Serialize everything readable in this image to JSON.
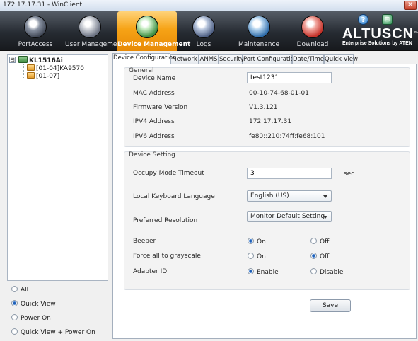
{
  "window": {
    "title": "172.17.17.31 - WinClient",
    "close_glyph": "✕"
  },
  "toolbar": {
    "items": [
      {
        "label": "PortAccess",
        "icon": "port-access-icon"
      },
      {
        "label": "User Management",
        "icon": "user-management-icon"
      },
      {
        "label": "Device Management",
        "icon": "device-management-icon",
        "active": true
      },
      {
        "label": "Logs",
        "icon": "logs-icon"
      },
      {
        "label": "Maintenance",
        "icon": "maintenance-icon"
      },
      {
        "label": "Download",
        "icon": "download-icon"
      }
    ],
    "help_glyph": "?",
    "config_glyph": "⊟",
    "brand": "ALTUSCN",
    "brand_tm": "™",
    "brand_sub": "Enterprise Solutions by ATEN"
  },
  "tree": {
    "expander": "⊟",
    "root": "KL1516Ai",
    "children": [
      "[01-04]KA9570",
      "[01-07]"
    ]
  },
  "view_options": [
    {
      "label": "All",
      "selected": false
    },
    {
      "label": "Quick View",
      "selected": true
    },
    {
      "label": "Power On",
      "selected": false
    },
    {
      "label": "Quick View + Power On",
      "selected": false
    }
  ],
  "tabs": [
    "Device Configuration",
    "Network",
    "ANMS",
    "Security",
    "Port Configuration",
    "Date/Time",
    "Quick View"
  ],
  "general": {
    "title": "General",
    "device_name_label": "Device Name",
    "device_name": "test1231",
    "mac_label": "MAC Address",
    "mac": "00-10-74-68-01-01",
    "firmware_label": "Firmware Version",
    "firmware": "V1.3.121",
    "ipv4_label": "IPV4 Address",
    "ipv4": "172.17.17.31",
    "ipv6_label": "IPV6 Address",
    "ipv6": "fe80::210:74ff:fe68:101"
  },
  "device_setting": {
    "title": "Device Setting",
    "occupy_label": "Occupy Mode Timeout",
    "occupy_value": "3",
    "occupy_unit": "sec",
    "keyboard_label": "Local Keyboard Language",
    "keyboard_value": "English (US)",
    "resolution_label": "Preferred Resolution",
    "resolution_value": "Monitor Default Setting",
    "beeper_label": "Beeper",
    "beeper_on": "On",
    "beeper_off": "Off",
    "beeper_selected": "On",
    "grayscale_label": "Force all to grayscale",
    "grayscale_on": "On",
    "grayscale_off": "Off",
    "grayscale_selected": "Off",
    "adapter_label": "Adapter ID",
    "adapter_enable": "Enable",
    "adapter_disable": "Disable",
    "adapter_selected": "Enable"
  },
  "save_label": "Save"
}
